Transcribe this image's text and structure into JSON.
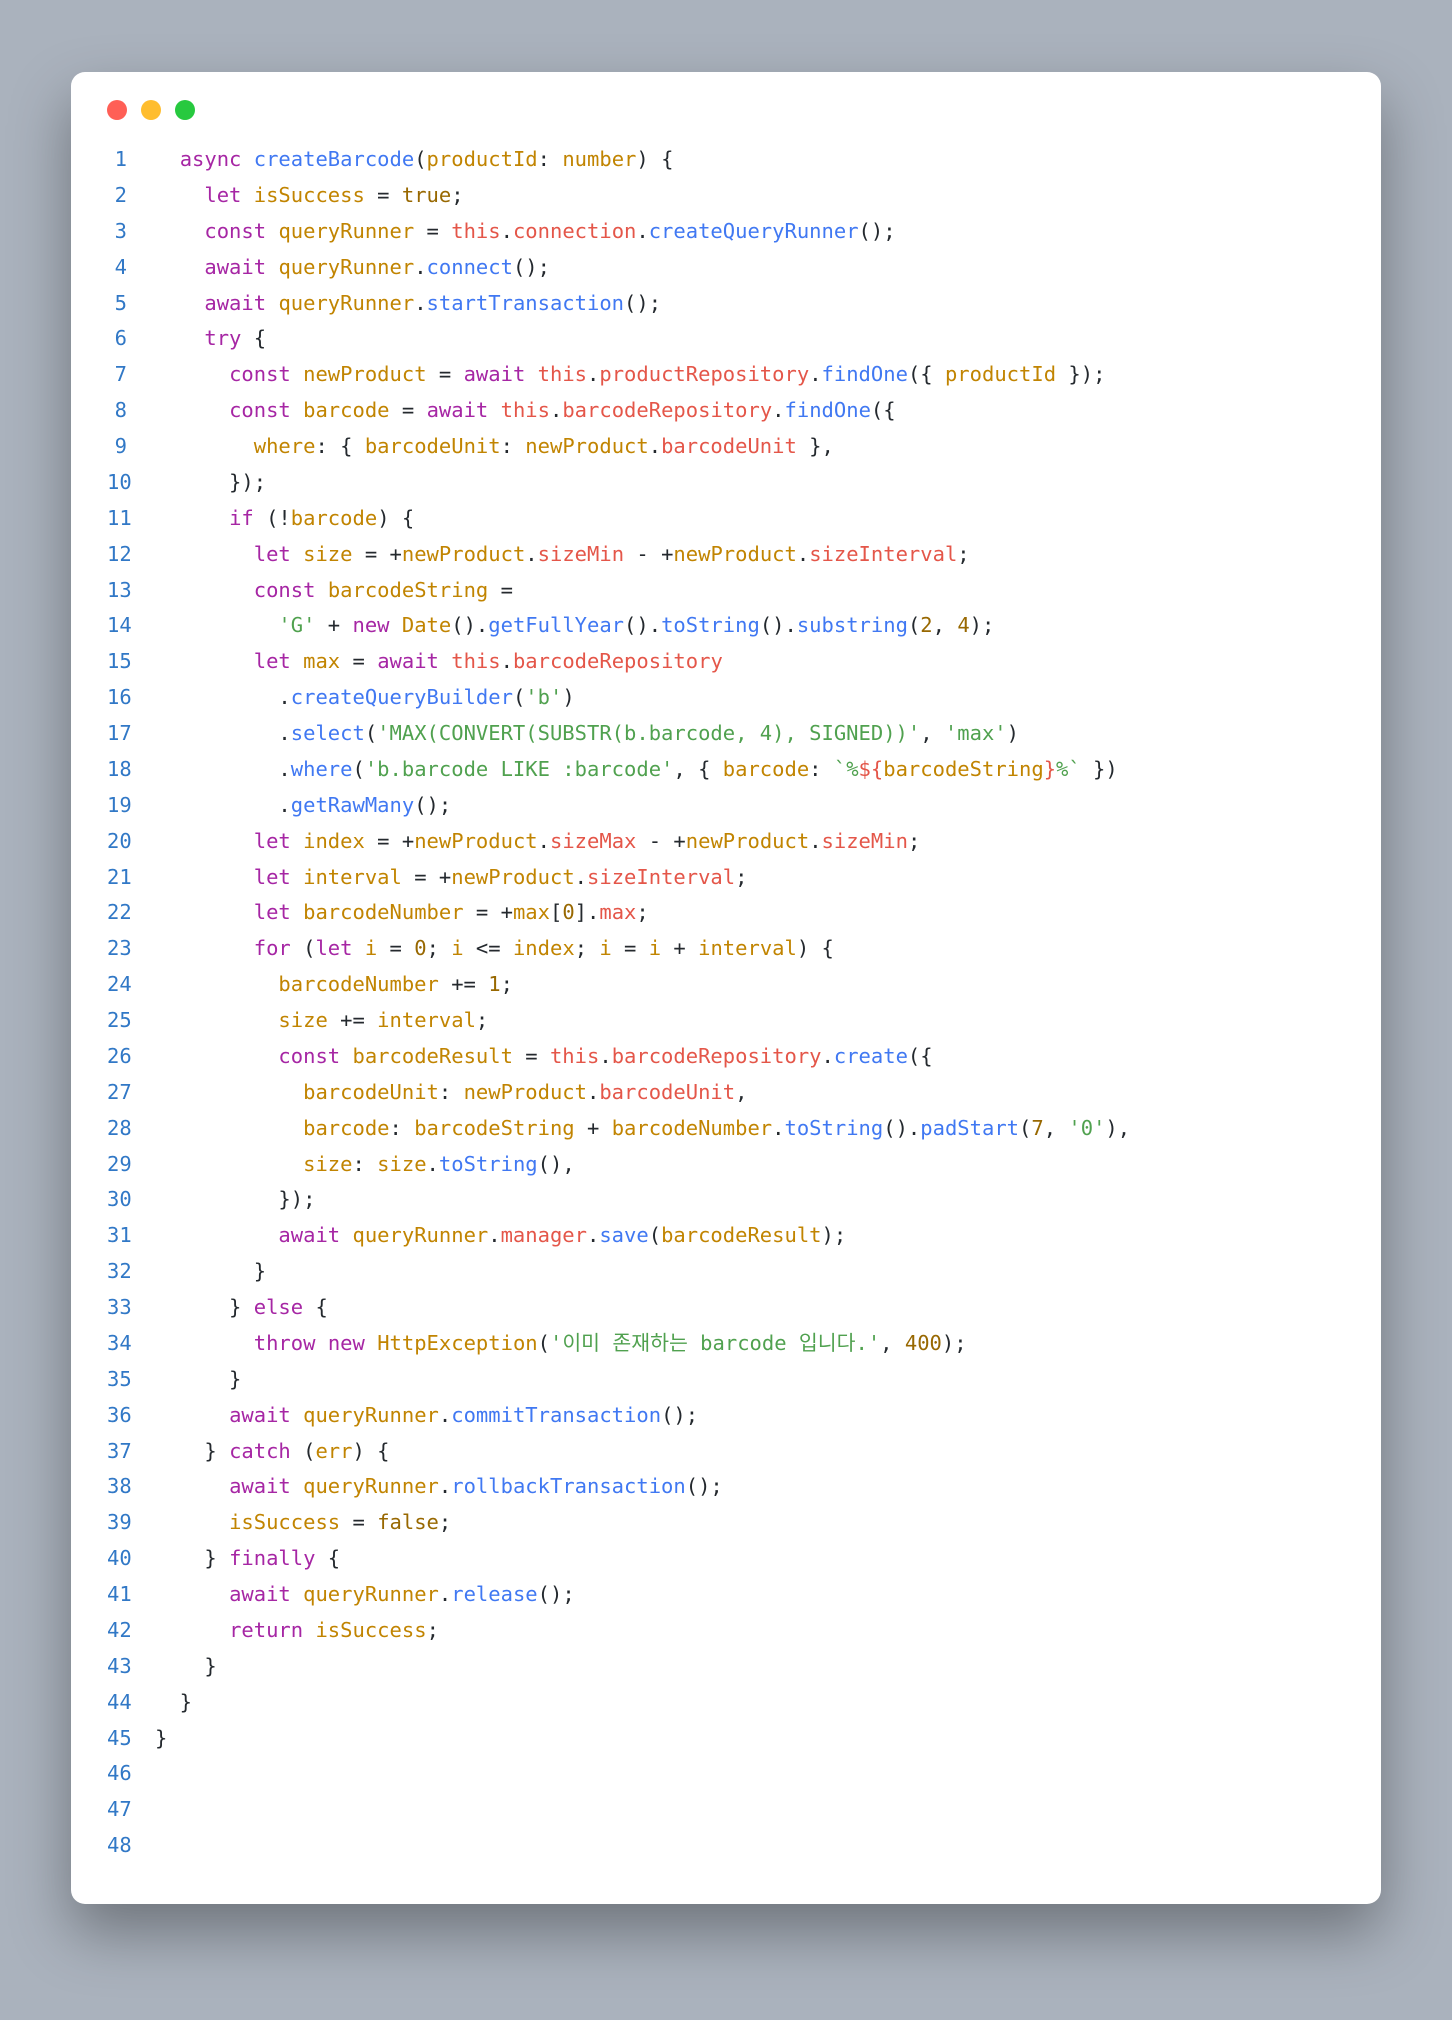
{
  "traffic": {
    "red": "#ff5f56",
    "yellow": "#ffbd2e",
    "green": "#27c93f"
  },
  "total_lines": 48,
  "code": {
    "l1": "  async createBarcode(productId: number) {",
    "l2": "    let isSuccess = true;",
    "l3": "    const queryRunner = this.connection.createQueryRunner();",
    "l4": "    await queryRunner.connect();",
    "l5": "    await queryRunner.startTransaction();",
    "l6": "    try {",
    "l7": "      const newProduct = await this.productRepository.findOne({ productId });",
    "l8": "      const barcode = await this.barcodeRepository.findOne({",
    "l9": "        where: { barcodeUnit: newProduct.barcodeUnit },",
    "l10": "      });",
    "l11": "      if (!barcode) {",
    "l12": "        let size = +newProduct.sizeMin - +newProduct.sizeInterval;",
    "l13": "        const barcodeString =",
    "l14": "          'G' + new Date().getFullYear().toString().substring(2, 4);",
    "l15": "        let max = await this.barcodeRepository",
    "l16": "          .createQueryBuilder('b')",
    "l17": "          .select('MAX(CONVERT(SUBSTR(b.barcode, 4), SIGNED))', 'max')",
    "l18": "          .where('b.barcode LIKE :barcode', { barcode: `%${barcodeString}%` })",
    "l19": "          .getRawMany();",
    "l20": "        let index = +newProduct.sizeMax - +newProduct.sizeMin;",
    "l21": "",
    "l22": "        let interval = +newProduct.sizeInterval;",
    "l23": "",
    "l24": "        let barcodeNumber = +max[0].max;",
    "l25": "",
    "l26": "        for (let i = 0; i <= index; i = i + interval) {",
    "l27": "          barcodeNumber += 1;",
    "l28": "          size += interval;",
    "l29": "          const barcodeResult = this.barcodeRepository.create({",
    "l30": "            barcodeUnit: newProduct.barcodeUnit,",
    "l31": "            barcode: barcodeString + barcodeNumber.toString().padStart(7, '0'),",
    "l32": "            size: size.toString(),",
    "l33": "          });",
    "l34": "          await queryRunner.manager.save(barcodeResult);",
    "l35": "        }",
    "l36": "      } else {",
    "l37": "        throw new HttpException('이미 존재하는 barcode 입니다.', 400);",
    "l38": "      }",
    "l39": "      await queryRunner.commitTransaction();",
    "l40": "    } catch (err) {",
    "l41": "      await queryRunner.rollbackTransaction();",
    "l42": "      isSuccess = false;",
    "l43": "    } finally {",
    "l44": "      await queryRunner.release();",
    "l45": "      return isSuccess;",
    "l46": "    }",
    "l47": "  }",
    "l48": "}"
  }
}
